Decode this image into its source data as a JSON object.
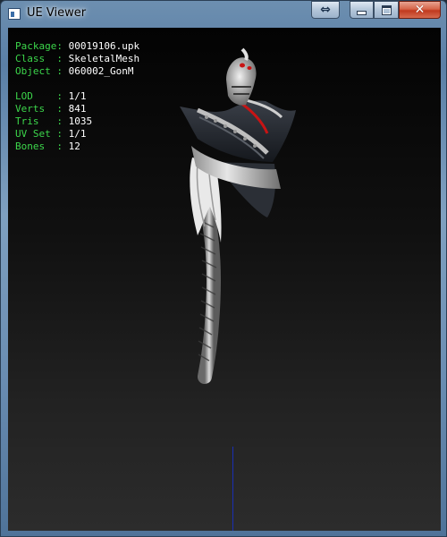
{
  "window": {
    "title": "UE Viewer",
    "icon": "app-window-icon",
    "buttons": {
      "restore_size": "⇔",
      "minimize": "minimize-icon",
      "maximize": "maximize-icon",
      "close": "✕"
    }
  },
  "info": {
    "package": {
      "key": "Package",
      "value": "00019106.upk"
    },
    "class": {
      "key": "Class  ",
      "value": "SkeletalMesh"
    },
    "object": {
      "key": "Object ",
      "value": "060002_GonM"
    },
    "lod": {
      "key": "LOD    ",
      "value": "1/1"
    },
    "verts": {
      "key": "Verts  ",
      "value": "841"
    },
    "tris": {
      "key": "Tris   ",
      "value": "1035"
    },
    "uvset": {
      "key": "UV Set ",
      "value": "1/1"
    },
    "bones": {
      "key": "Bones  ",
      "value": "12"
    }
  },
  "colors": {
    "label": "#3cd64b",
    "value": "#ffffff",
    "axis": "#1a2fb4",
    "accent_red": "#c81414"
  }
}
